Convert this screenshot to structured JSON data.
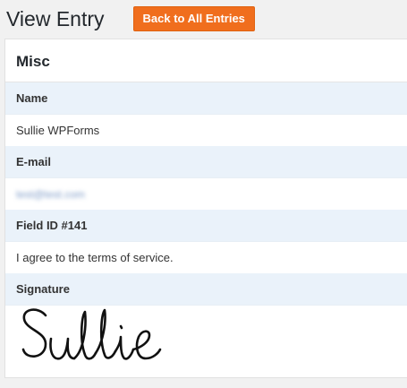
{
  "header": {
    "title": "View Entry",
    "back_label": "Back to All Entries"
  },
  "entry": {
    "section_title": "Misc",
    "fields": [
      {
        "label": "Name",
        "value": "Sullie WPForms"
      },
      {
        "label": "E-mail",
        "value": "test@test.com"
      },
      {
        "label": "Field ID #141",
        "value": "I agree to the terms of service."
      },
      {
        "label": "Signature",
        "value": "Sullie"
      }
    ]
  },
  "colors": {
    "accent": "#f06e1d",
    "field_label_bg": "#eaf2fa"
  }
}
